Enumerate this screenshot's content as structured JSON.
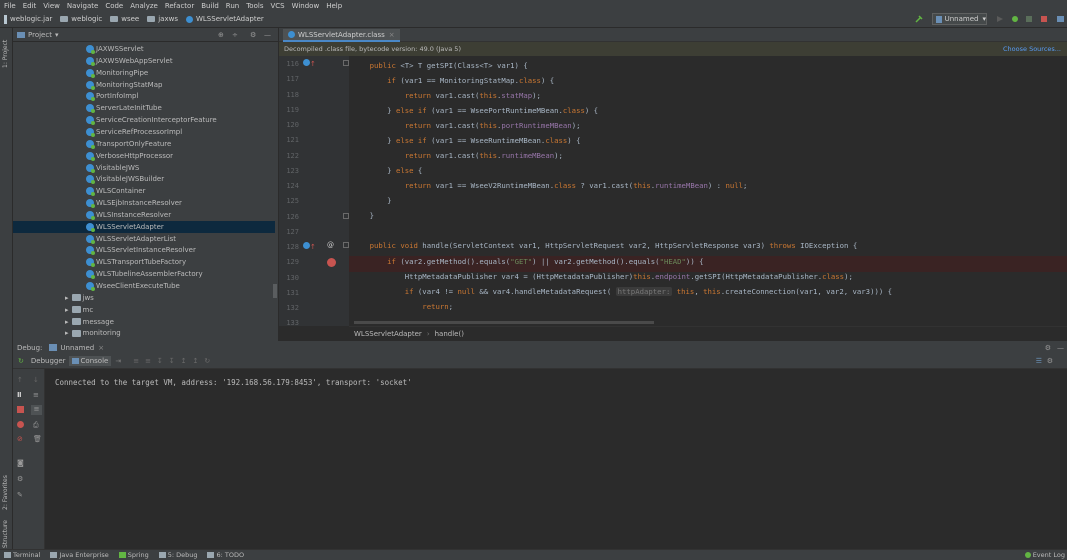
{
  "menu": [
    "File",
    "Edit",
    "View",
    "Navigate",
    "Code",
    "Analyze",
    "Refactor",
    "Build",
    "Run",
    "Tools",
    "VCS",
    "Window",
    "Help"
  ],
  "breadcrumbs": [
    "weblogic.jar",
    "weblogic",
    "wsee",
    "jaxws",
    "WLSServletAdapter"
  ],
  "run_config": "Unnamed",
  "project": {
    "title": "Project",
    "classes": [
      "JAXWSServlet",
      "JAXWSWebAppServlet",
      "MonitoringPipe",
      "MonitoringStatMap",
      "PortInfoImpl",
      "ServerLateInitTube",
      "ServiceCreationInterceptorFeature",
      "ServiceRefProcessorImpl",
      "TransportOnlyFeature",
      "VerboseHttpProcessor",
      "VisitableJWS",
      "VisitableJWSBuilder",
      "WLSContainer",
      "WLSEjbInstanceResolver",
      "WLSInstanceResolver",
      "WLSServletAdapter",
      "WLSServletAdapterList",
      "WLSServletInstanceResolver",
      "WLSTransportTubeFactory",
      "WLSTubelineAssemblerFactory",
      "WseeClientExecuteTube"
    ],
    "selected": "WLSServletAdapter",
    "packages": [
      "jws",
      "mc",
      "message",
      "monitoring"
    ]
  },
  "editor": {
    "tab": "WLSServletAdapter.class",
    "banner": "Decompiled .class file, bytecode version: 49.0 (Java 5)",
    "choose_sources": "Choose Sources...",
    "line_numbers": [
      "116",
      "117",
      "118",
      "119",
      "120",
      "121",
      "122",
      "123",
      "124",
      "125",
      "126",
      "127",
      "128",
      "129",
      "130",
      "131",
      "132",
      "133"
    ],
    "breadcrumb": [
      "WLSServletAdapter",
      "handle()"
    ],
    "hint": "httpAdapter:"
  },
  "debug": {
    "title": "Debug:",
    "session": "Unnamed",
    "tabs": [
      "Debugger",
      "Console"
    ],
    "console_line": "Connected to the target VM, address: '192.168.56.179:8453', transport: 'socket'"
  },
  "side_labels": [
    "1: Project",
    "2: Favorites",
    "Z: Structure"
  ],
  "statusbar": {
    "items": [
      "Terminal",
      "Java Enterprise",
      "Spring",
      "5: Debug",
      "6: TODO"
    ],
    "right": "Event Log"
  }
}
